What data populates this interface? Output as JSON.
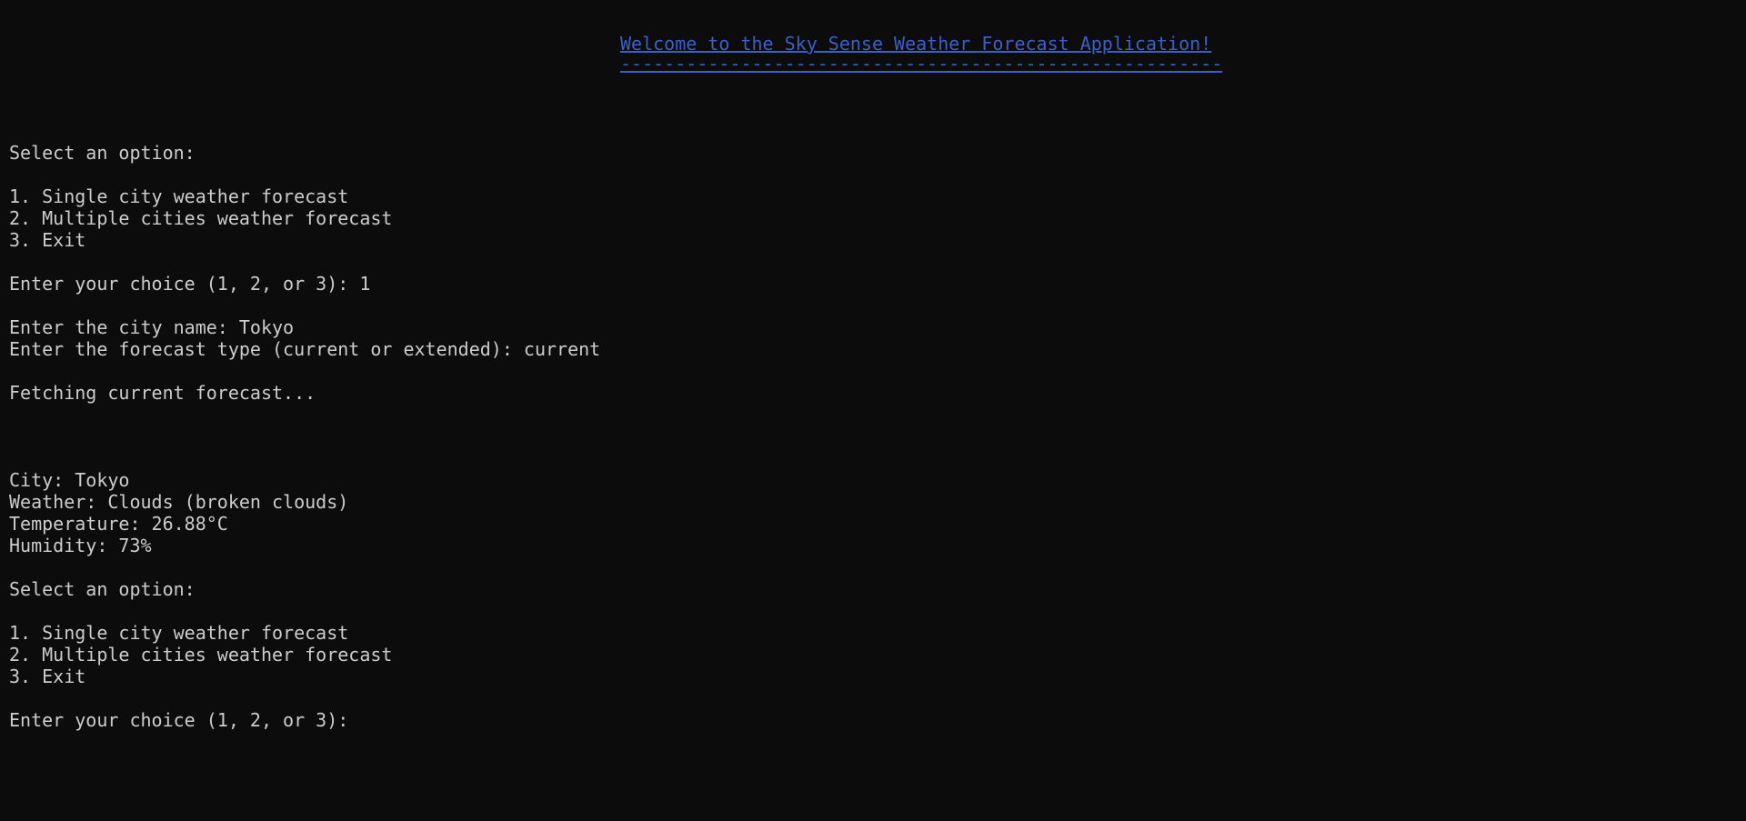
{
  "banner": {
    "title": "Welcome to the Sky Sense Weather Forecast Application!",
    "rule": "-------------------------------------------------------"
  },
  "session": {
    "menu1_prompt": "Select an option:",
    "menu1_option1": "1. Single city weather forecast",
    "menu1_option2": "2. Multiple cities weather forecast",
    "menu1_option3": "3. Exit",
    "choice1": "Enter your choice (1, 2, or 3): 1",
    "city_prompt": "Enter the city name: Tokyo",
    "type_prompt": "Enter the forecast type (current or extended): current",
    "fetching": "Fetching current forecast...",
    "result_city": "City: Tokyo",
    "result_weather": "Weather: Clouds (broken clouds)",
    "result_temperature": "Temperature: 26.88°C",
    "result_humidity": "Humidity: 73%",
    "menu2_prompt": "Select an option:",
    "menu2_option1": "1. Single city weather forecast",
    "menu2_option2": "2. Multiple cities weather forecast",
    "menu2_option3": "3. Exit",
    "choice2": "Enter your choice (1, 2, or 3): "
  }
}
